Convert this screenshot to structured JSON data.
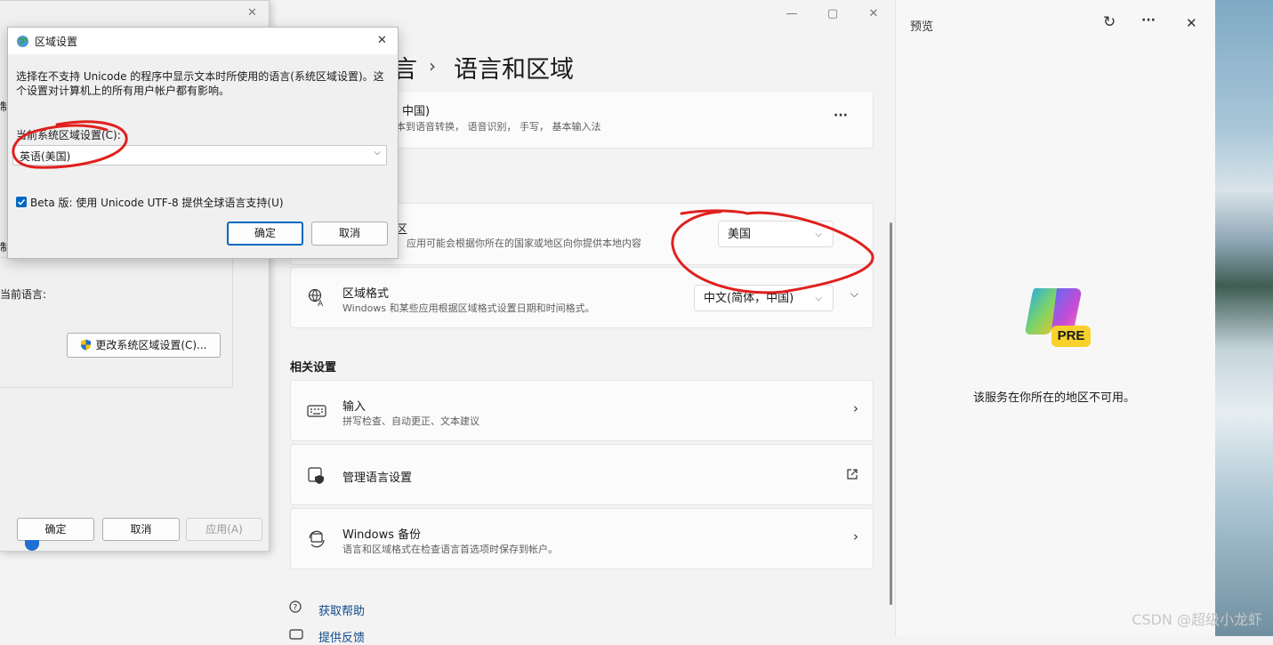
{
  "settings": {
    "breadcrumb_prev": "言",
    "page_title": "语言和区域",
    "lang_card": {
      "title": "，中国)",
      "subtitle": "本到语音转换， 语音识别， 手写， 基本输入法",
      "more": "···"
    },
    "country_card": {
      "title": "区",
      "subtitle": "应用可能会根据你所在的国家或地区向你提供本地内容",
      "value": "美国"
    },
    "format_card": {
      "title": "区域格式",
      "subtitle": "Windows 和某些应用根据区域格式设置日期和时间格式。",
      "value": "中文(简体，中国)"
    },
    "related_heading": "相关设置",
    "input_card": {
      "title": "输入",
      "subtitle": "拼写检查、自动更正、文本建议"
    },
    "manage_card": {
      "title": "管理语言设置"
    },
    "backup_card": {
      "title": "Windows 备份",
      "subtitle": "语言和区域格式在检查语言首选项时保存到帐户。"
    },
    "help_link": "获取帮助",
    "feedback_link": "提供反馈",
    "window_controls": {
      "minimize": "—",
      "maximize": "▢",
      "close": "✕"
    }
  },
  "region_window": {
    "frag_1": "制",
    "frag_2": "制",
    "current_lang_label": "当前语言:",
    "change_locale_button": "更改系统区域设置(C)...",
    "ok": "确定",
    "cancel": "取消",
    "apply": "应用(A)",
    "close": "✕"
  },
  "dialog": {
    "title": "区域设置",
    "close": "✕",
    "description": "选择在不支持 Unicode 的程序中显示文本时所使用的语言(系统区域设置)。这个设置对计算机上的所有用户帐户都有影响。",
    "current_label": "当前系统区域设置(C):",
    "current_value": "英语(美国)",
    "beta_label": "Beta 版: 使用 Unicode UTF-8 提供全球语言支持(U)",
    "beta_checked": true,
    "ok": "确定",
    "cancel": "取消"
  },
  "copilot": {
    "title": "预览",
    "refresh": "↻",
    "more": "···",
    "close": "✕",
    "badge": "PRE",
    "message": "该服务在你所在的地区不可用。"
  },
  "watermark": "CSDN @超级小龙虾",
  "colors": {
    "accent": "#0067c0",
    "annotation": "#e0201e"
  }
}
